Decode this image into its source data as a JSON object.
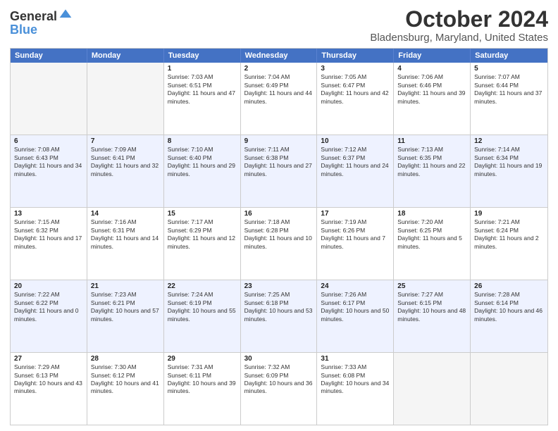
{
  "logo": {
    "general": "General",
    "blue": "Blue"
  },
  "title": "October 2024",
  "location": "Bladensburg, Maryland, United States",
  "days_of_week": [
    "Sunday",
    "Monday",
    "Tuesday",
    "Wednesday",
    "Thursday",
    "Friday",
    "Saturday"
  ],
  "weeks": [
    [
      {
        "day": "",
        "sunrise": "",
        "sunset": "",
        "daylight": "",
        "empty": true
      },
      {
        "day": "",
        "sunrise": "",
        "sunset": "",
        "daylight": "",
        "empty": true
      },
      {
        "day": "1",
        "sunrise": "Sunrise: 7:03 AM",
        "sunset": "Sunset: 6:51 PM",
        "daylight": "Daylight: 11 hours and 47 minutes."
      },
      {
        "day": "2",
        "sunrise": "Sunrise: 7:04 AM",
        "sunset": "Sunset: 6:49 PM",
        "daylight": "Daylight: 11 hours and 44 minutes."
      },
      {
        "day": "3",
        "sunrise": "Sunrise: 7:05 AM",
        "sunset": "Sunset: 6:47 PM",
        "daylight": "Daylight: 11 hours and 42 minutes."
      },
      {
        "day": "4",
        "sunrise": "Sunrise: 7:06 AM",
        "sunset": "Sunset: 6:46 PM",
        "daylight": "Daylight: 11 hours and 39 minutes."
      },
      {
        "day": "5",
        "sunrise": "Sunrise: 7:07 AM",
        "sunset": "Sunset: 6:44 PM",
        "daylight": "Daylight: 11 hours and 37 minutes."
      }
    ],
    [
      {
        "day": "6",
        "sunrise": "Sunrise: 7:08 AM",
        "sunset": "Sunset: 6:43 PM",
        "daylight": "Daylight: 11 hours and 34 minutes."
      },
      {
        "day": "7",
        "sunrise": "Sunrise: 7:09 AM",
        "sunset": "Sunset: 6:41 PM",
        "daylight": "Daylight: 11 hours and 32 minutes."
      },
      {
        "day": "8",
        "sunrise": "Sunrise: 7:10 AM",
        "sunset": "Sunset: 6:40 PM",
        "daylight": "Daylight: 11 hours and 29 minutes."
      },
      {
        "day": "9",
        "sunrise": "Sunrise: 7:11 AM",
        "sunset": "Sunset: 6:38 PM",
        "daylight": "Daylight: 11 hours and 27 minutes."
      },
      {
        "day": "10",
        "sunrise": "Sunrise: 7:12 AM",
        "sunset": "Sunset: 6:37 PM",
        "daylight": "Daylight: 11 hours and 24 minutes."
      },
      {
        "day": "11",
        "sunrise": "Sunrise: 7:13 AM",
        "sunset": "Sunset: 6:35 PM",
        "daylight": "Daylight: 11 hours and 22 minutes."
      },
      {
        "day": "12",
        "sunrise": "Sunrise: 7:14 AM",
        "sunset": "Sunset: 6:34 PM",
        "daylight": "Daylight: 11 hours and 19 minutes."
      }
    ],
    [
      {
        "day": "13",
        "sunrise": "Sunrise: 7:15 AM",
        "sunset": "Sunset: 6:32 PM",
        "daylight": "Daylight: 11 hours and 17 minutes."
      },
      {
        "day": "14",
        "sunrise": "Sunrise: 7:16 AM",
        "sunset": "Sunset: 6:31 PM",
        "daylight": "Daylight: 11 hours and 14 minutes."
      },
      {
        "day": "15",
        "sunrise": "Sunrise: 7:17 AM",
        "sunset": "Sunset: 6:29 PM",
        "daylight": "Daylight: 11 hours and 12 minutes."
      },
      {
        "day": "16",
        "sunrise": "Sunrise: 7:18 AM",
        "sunset": "Sunset: 6:28 PM",
        "daylight": "Daylight: 11 hours and 10 minutes."
      },
      {
        "day": "17",
        "sunrise": "Sunrise: 7:19 AM",
        "sunset": "Sunset: 6:26 PM",
        "daylight": "Daylight: 11 hours and 7 minutes."
      },
      {
        "day": "18",
        "sunrise": "Sunrise: 7:20 AM",
        "sunset": "Sunset: 6:25 PM",
        "daylight": "Daylight: 11 hours and 5 minutes."
      },
      {
        "day": "19",
        "sunrise": "Sunrise: 7:21 AM",
        "sunset": "Sunset: 6:24 PM",
        "daylight": "Daylight: 11 hours and 2 minutes."
      }
    ],
    [
      {
        "day": "20",
        "sunrise": "Sunrise: 7:22 AM",
        "sunset": "Sunset: 6:22 PM",
        "daylight": "Daylight: 11 hours and 0 minutes."
      },
      {
        "day": "21",
        "sunrise": "Sunrise: 7:23 AM",
        "sunset": "Sunset: 6:21 PM",
        "daylight": "Daylight: 10 hours and 57 minutes."
      },
      {
        "day": "22",
        "sunrise": "Sunrise: 7:24 AM",
        "sunset": "Sunset: 6:19 PM",
        "daylight": "Daylight: 10 hours and 55 minutes."
      },
      {
        "day": "23",
        "sunrise": "Sunrise: 7:25 AM",
        "sunset": "Sunset: 6:18 PM",
        "daylight": "Daylight: 10 hours and 53 minutes."
      },
      {
        "day": "24",
        "sunrise": "Sunrise: 7:26 AM",
        "sunset": "Sunset: 6:17 PM",
        "daylight": "Daylight: 10 hours and 50 minutes."
      },
      {
        "day": "25",
        "sunrise": "Sunrise: 7:27 AM",
        "sunset": "Sunset: 6:15 PM",
        "daylight": "Daylight: 10 hours and 48 minutes."
      },
      {
        "day": "26",
        "sunrise": "Sunrise: 7:28 AM",
        "sunset": "Sunset: 6:14 PM",
        "daylight": "Daylight: 10 hours and 46 minutes."
      }
    ],
    [
      {
        "day": "27",
        "sunrise": "Sunrise: 7:29 AM",
        "sunset": "Sunset: 6:13 PM",
        "daylight": "Daylight: 10 hours and 43 minutes."
      },
      {
        "day": "28",
        "sunrise": "Sunrise: 7:30 AM",
        "sunset": "Sunset: 6:12 PM",
        "daylight": "Daylight: 10 hours and 41 minutes."
      },
      {
        "day": "29",
        "sunrise": "Sunrise: 7:31 AM",
        "sunset": "Sunset: 6:11 PM",
        "daylight": "Daylight: 10 hours and 39 minutes."
      },
      {
        "day": "30",
        "sunrise": "Sunrise: 7:32 AM",
        "sunset": "Sunset: 6:09 PM",
        "daylight": "Daylight: 10 hours and 36 minutes."
      },
      {
        "day": "31",
        "sunrise": "Sunrise: 7:33 AM",
        "sunset": "Sunset: 6:08 PM",
        "daylight": "Daylight: 10 hours and 34 minutes."
      },
      {
        "day": "",
        "sunrise": "",
        "sunset": "",
        "daylight": "",
        "empty": true
      },
      {
        "day": "",
        "sunrise": "",
        "sunset": "",
        "daylight": "",
        "empty": true
      }
    ]
  ]
}
